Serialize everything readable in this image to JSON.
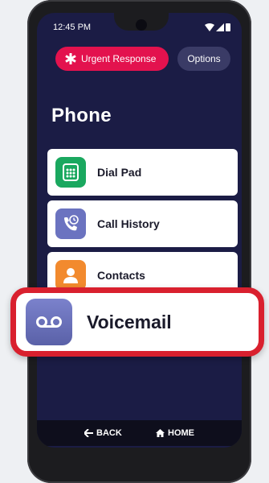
{
  "status_bar": {
    "time": "12:45 PM"
  },
  "header": {
    "urgent_label": "Urgent Response",
    "options_label": "Options",
    "title": "Phone"
  },
  "menu": {
    "items": [
      {
        "label": "Dial Pad",
        "icon": "dial-pad-icon",
        "color": "#1aa85f"
      },
      {
        "label": "Call History",
        "icon": "call-history-icon",
        "color": "#6b73c0"
      },
      {
        "label": "Contacts",
        "icon": "contacts-icon",
        "color": "#f28a2e"
      },
      {
        "label": "Voicemail",
        "icon": "voicemail-icon",
        "color": "#6b73c0"
      }
    ]
  },
  "navbar": {
    "back_label": "BACK",
    "home_label": "HOME"
  },
  "colors": {
    "screen_bg": "#1b1c45",
    "urgent": "#e3124e",
    "highlight_border": "#d9202e"
  }
}
